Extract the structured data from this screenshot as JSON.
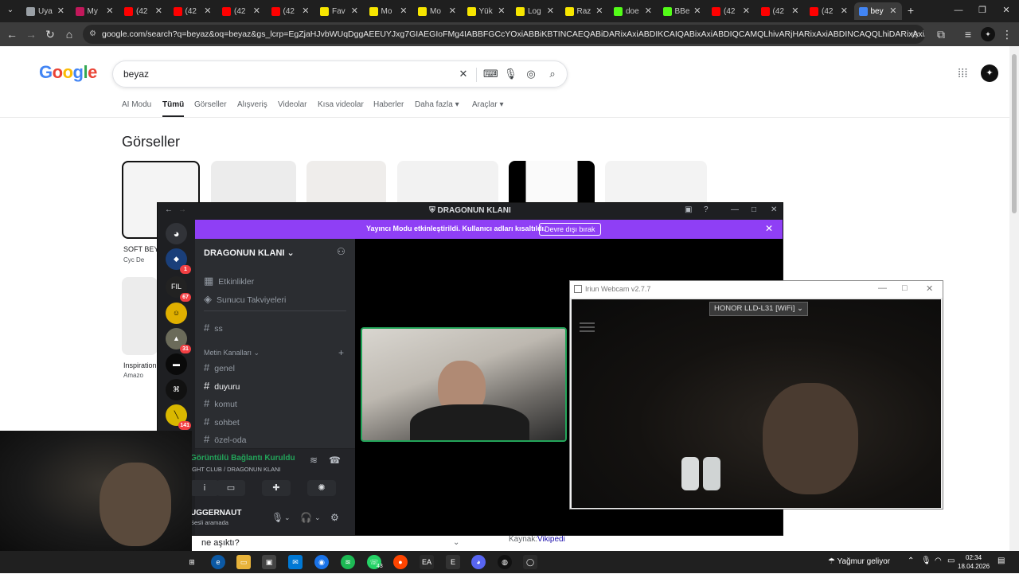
{
  "browser": {
    "tabs": [
      {
        "label": "Uya",
        "color": "#9aa0a6"
      },
      {
        "label": "My",
        "color": "#c2185b"
      },
      {
        "label": "(42",
        "color": "#ff0000"
      },
      {
        "label": "(42",
        "color": "#ff0000"
      },
      {
        "label": "(42",
        "color": "#ff0000"
      },
      {
        "label": "(42",
        "color": "#ff0000"
      },
      {
        "label": "Fav",
        "color": "#f7e600"
      },
      {
        "label": "Mo",
        "color": "#f7e600"
      },
      {
        "label": "Mo",
        "color": "#f7e600"
      },
      {
        "label": "Yük",
        "color": "#f7e600"
      },
      {
        "label": "Log",
        "color": "#f7e600"
      },
      {
        "label": "Raz",
        "color": "#f7e600"
      },
      {
        "label": "doe",
        "color": "#53fc18"
      },
      {
        "label": "BBe",
        "color": "#53fc18"
      },
      {
        "label": "(42",
        "color": "#ff0000"
      },
      {
        "label": "(42",
        "color": "#ff0000"
      },
      {
        "label": "(42",
        "color": "#ff0000"
      },
      {
        "label": "bey",
        "color": "#4285f4"
      }
    ],
    "tab_close": "✕",
    "new_tab": "+",
    "url": "google.com/search?q=beyaz&oq=beyaz&gs_lcrp=EgZjaHJvbWUqDggAEEUYJxg7GIAEGIoFMg4IABBFGCcYOxiABBiKBTINCAEQABiDARixAxiABDIKCAIQABixAxiABDIQCAMQLhivARjHARixAxiABDINCAQQLhiDARixAxiABDIHCAUQABiABDIQCAYQAB"
  },
  "google": {
    "logo": "Google",
    "query": "beyaz",
    "tabs": [
      "AI Modu",
      "Tümü",
      "Görseller",
      "Alışveriş",
      "Videolar",
      "Kısa videolar",
      "Haberler",
      "Daha fazla",
      "Araçlar"
    ],
    "active_tab": "Tümü",
    "images_title": "Görseller",
    "results": [
      {
        "caption": "SOFT BEY",
        "source": "Cyc De"
      },
      {
        "caption": "Inspiration",
        "source": "Amazo"
      }
    ],
    "question": "ne aşıktı?",
    "kaynak_label": "Kaynak:",
    "kaynak_link": "Vikipedi"
  },
  "discord": {
    "title": "DRAGONUN KLANI",
    "banner_text": "Yayıncı Modu etkinleştirildi. Kullanıcı adları kısaltıldı.",
    "banner_button": "Devre dışı bırak",
    "guild_name": "DRAGONUN KLANI",
    "server_badges": [
      "1",
      "67",
      "31",
      "141"
    ],
    "menu_items": [
      "Etkinlikler",
      "Sunucu Takviyeleri"
    ],
    "channel_ss": "ss",
    "category": "Metin Kanalları",
    "channels": [
      "genel",
      "duyuru",
      "komut",
      "sohbet",
      "özel-oda"
    ],
    "voice_status": "Görüntülü Bağlantı Kuruldu",
    "voice_sub": "IGHT CLUB / DRAGONUN KLANI",
    "username": "UGGERNAUT",
    "user_status": "Sesli aramada"
  },
  "webcam": {
    "title": "Iriun Webcam v2.7.7",
    "device": "HONOR LLD-L31 [WiFi]"
  },
  "taskbar": {
    "weather": "Yağmur geliyor",
    "time": "02:34",
    "date": "18.04.2026",
    "whatsapp_badge": "43"
  },
  "colors": {
    "discord_accent": "#8f3ff5",
    "voice_green": "#23a55a",
    "badge_red": "#f23f43"
  }
}
